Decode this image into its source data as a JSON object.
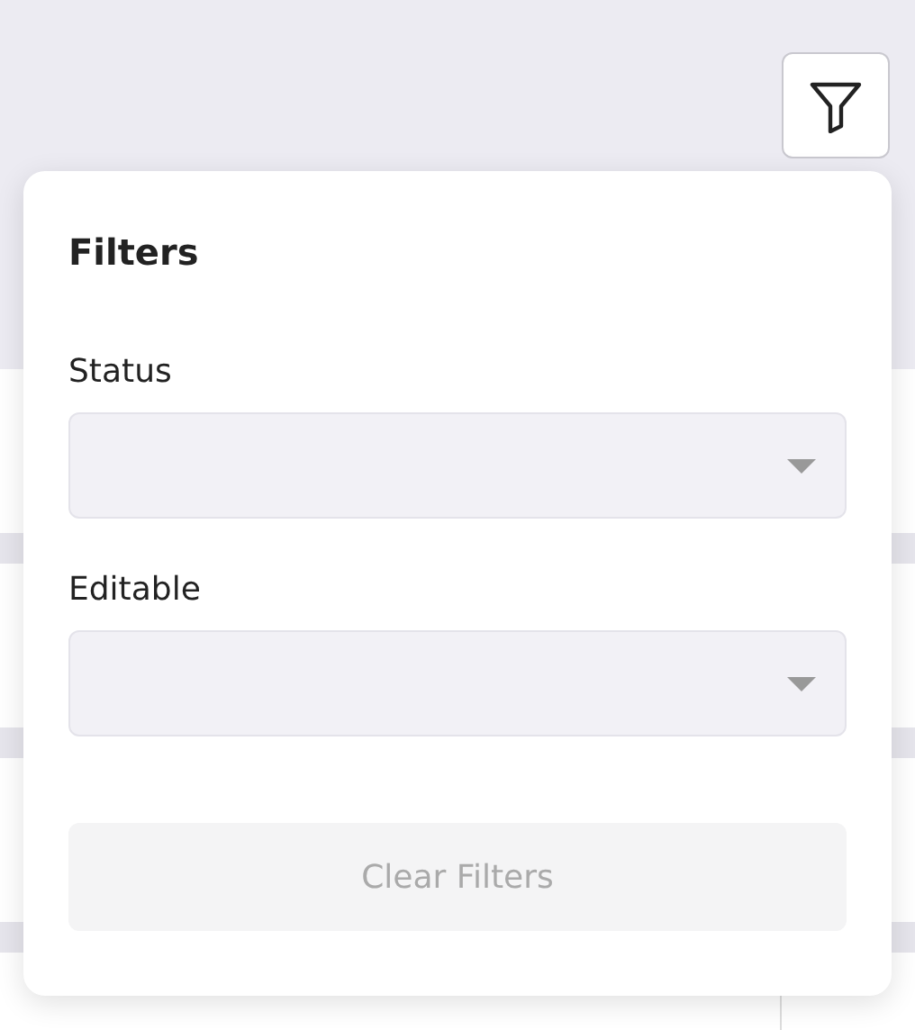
{
  "filters_popover": {
    "title": "Filters",
    "fields": [
      {
        "label": "Status"
      },
      {
        "label": "Editable"
      }
    ],
    "clear_button": {
      "label": "Clear Filters",
      "disabled": true
    }
  }
}
